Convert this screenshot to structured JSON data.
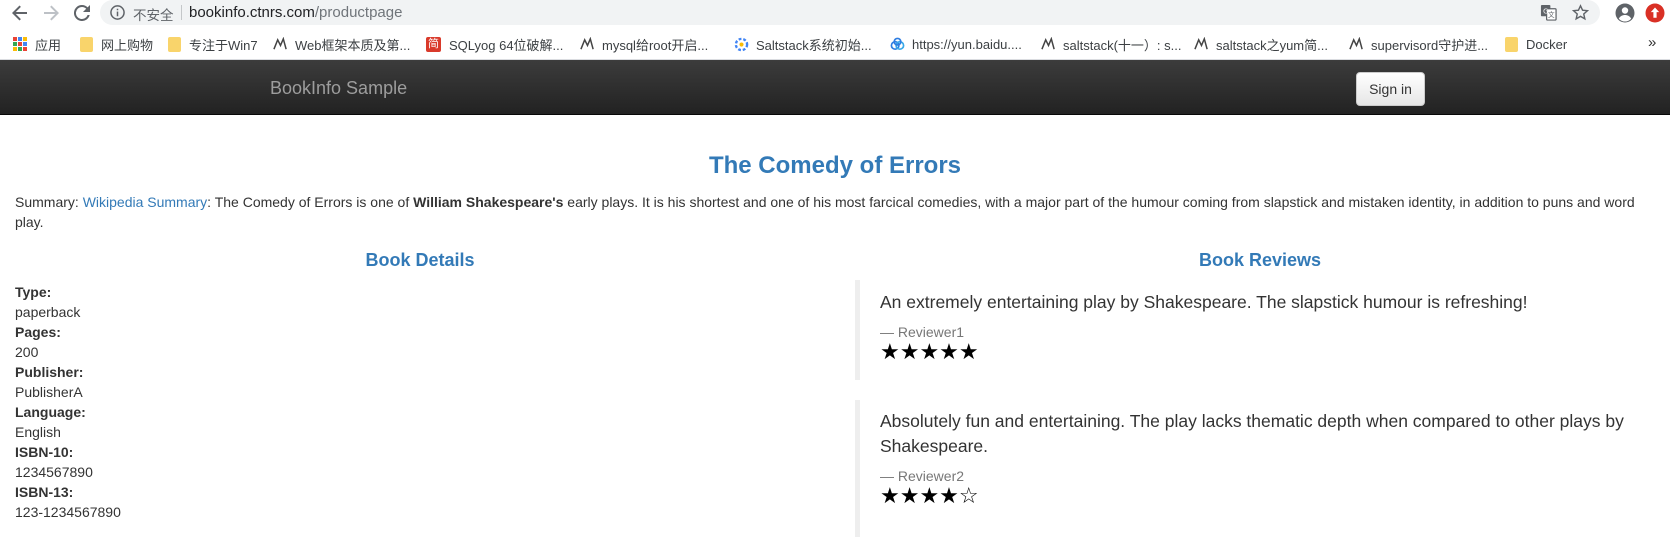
{
  "browser": {
    "url_insecure": "不安全",
    "url_host": "bookinfo.ctnrs.com",
    "url_path": "/productpage",
    "bookmarks": [
      {
        "label": "应用",
        "icon": "apps-grid-icon"
      },
      {
        "label": "网上购物",
        "icon": "folder-icon"
      },
      {
        "label": "专注于Win7",
        "icon": "folder-icon"
      },
      {
        "label": "Web框架本质及第...",
        "icon": "site-icon"
      },
      {
        "label": "SQLyog 64位破解...",
        "icon": "jian-icon",
        "glyph": "简"
      },
      {
        "label": "mysql给root开启...",
        "icon": "site-icon"
      },
      {
        "label": "Saltstack系统初始...",
        "icon": "gear-icon"
      },
      {
        "label": "https://yun.baidu....",
        "icon": "cloud-icon"
      },
      {
        "label": "saltstack(十一）: s...",
        "icon": "site-icon"
      },
      {
        "label": "saltstack之yum简...",
        "icon": "site-icon"
      },
      {
        "label": "supervisord守护进...",
        "icon": "site-icon"
      },
      {
        "label": "Docker",
        "icon": "folder-icon"
      }
    ]
  },
  "navbar": {
    "brand": "BookInfo Sample",
    "signin_label": "Sign in"
  },
  "product": {
    "title": "The Comedy of Errors",
    "summary_prefix": "Summary: ",
    "summary_link": "Wikipedia Summary",
    "summary_mid": ": The Comedy of Errors is one of ",
    "summary_bold": "William Shakespeare's",
    "summary_rest": " early plays. It is his shortest and one of his most farcical comedies, with a major part of the humour coming from slapstick and mistaken identity, in addition to puns and word play."
  },
  "details": {
    "heading": "Book Details",
    "fields": [
      {
        "label": "Type:",
        "value": "paperback"
      },
      {
        "label": "Pages:",
        "value": "200"
      },
      {
        "label": "Publisher:",
        "value": "PublisherA"
      },
      {
        "label": "Language:",
        "value": "English"
      },
      {
        "label": "ISBN-10:",
        "value": "1234567890"
      },
      {
        "label": "ISBN-13:",
        "value": "123-1234567890"
      }
    ]
  },
  "reviews": {
    "heading": "Book Reviews",
    "items": [
      {
        "text": "An extremely entertaining play by Shakespeare. The slapstick humour is refreshing!",
        "reviewer": "— Reviewer1",
        "rating": 5,
        "stars": "★★★★★"
      },
      {
        "text": "Absolutely fun and entertaining. The play lacks thematic depth when compared to other plays by Shakespeare.",
        "reviewer": "— Reviewer2",
        "rating": 4,
        "stars": "★★★★☆"
      }
    ]
  }
}
